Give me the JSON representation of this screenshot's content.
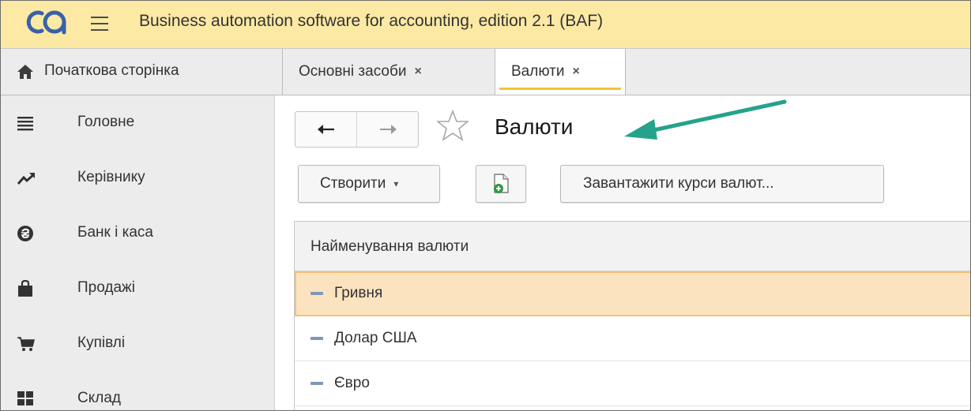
{
  "window": {
    "title": "Business automation software for accounting, edition 2.1  (BAF)",
    "accent_color": "#fbe9a4"
  },
  "tabs": {
    "home_label": "Початкова сторінка",
    "items": [
      {
        "label": "Основні засоби",
        "close": "×"
      },
      {
        "label": "Валюти",
        "close": "×"
      }
    ]
  },
  "sidebar": {
    "items": [
      {
        "label": "Головне",
        "icon": "menu-lines-icon"
      },
      {
        "label": "Керівнику",
        "icon": "trend-icon"
      },
      {
        "label": "Банк і каса",
        "icon": "hryvnia-coin-icon"
      },
      {
        "label": "Продажі",
        "icon": "shopping-bag-icon"
      },
      {
        "label": "Купівлі",
        "icon": "cart-icon"
      },
      {
        "label": "Склад",
        "icon": "grid-icon"
      }
    ]
  },
  "page": {
    "title": "Валюти",
    "nav": {
      "back": "←",
      "forward": "→"
    }
  },
  "toolbar": {
    "create_label": "Створити",
    "create_caret": "▾",
    "load_rates_label": "Завантажити курси валют..."
  },
  "table": {
    "header": "Найменування валюти",
    "selected_color": "#fbe3bf",
    "rows": [
      {
        "name": "Гривня"
      },
      {
        "name": "Долар США"
      },
      {
        "name": "Євро"
      }
    ]
  }
}
